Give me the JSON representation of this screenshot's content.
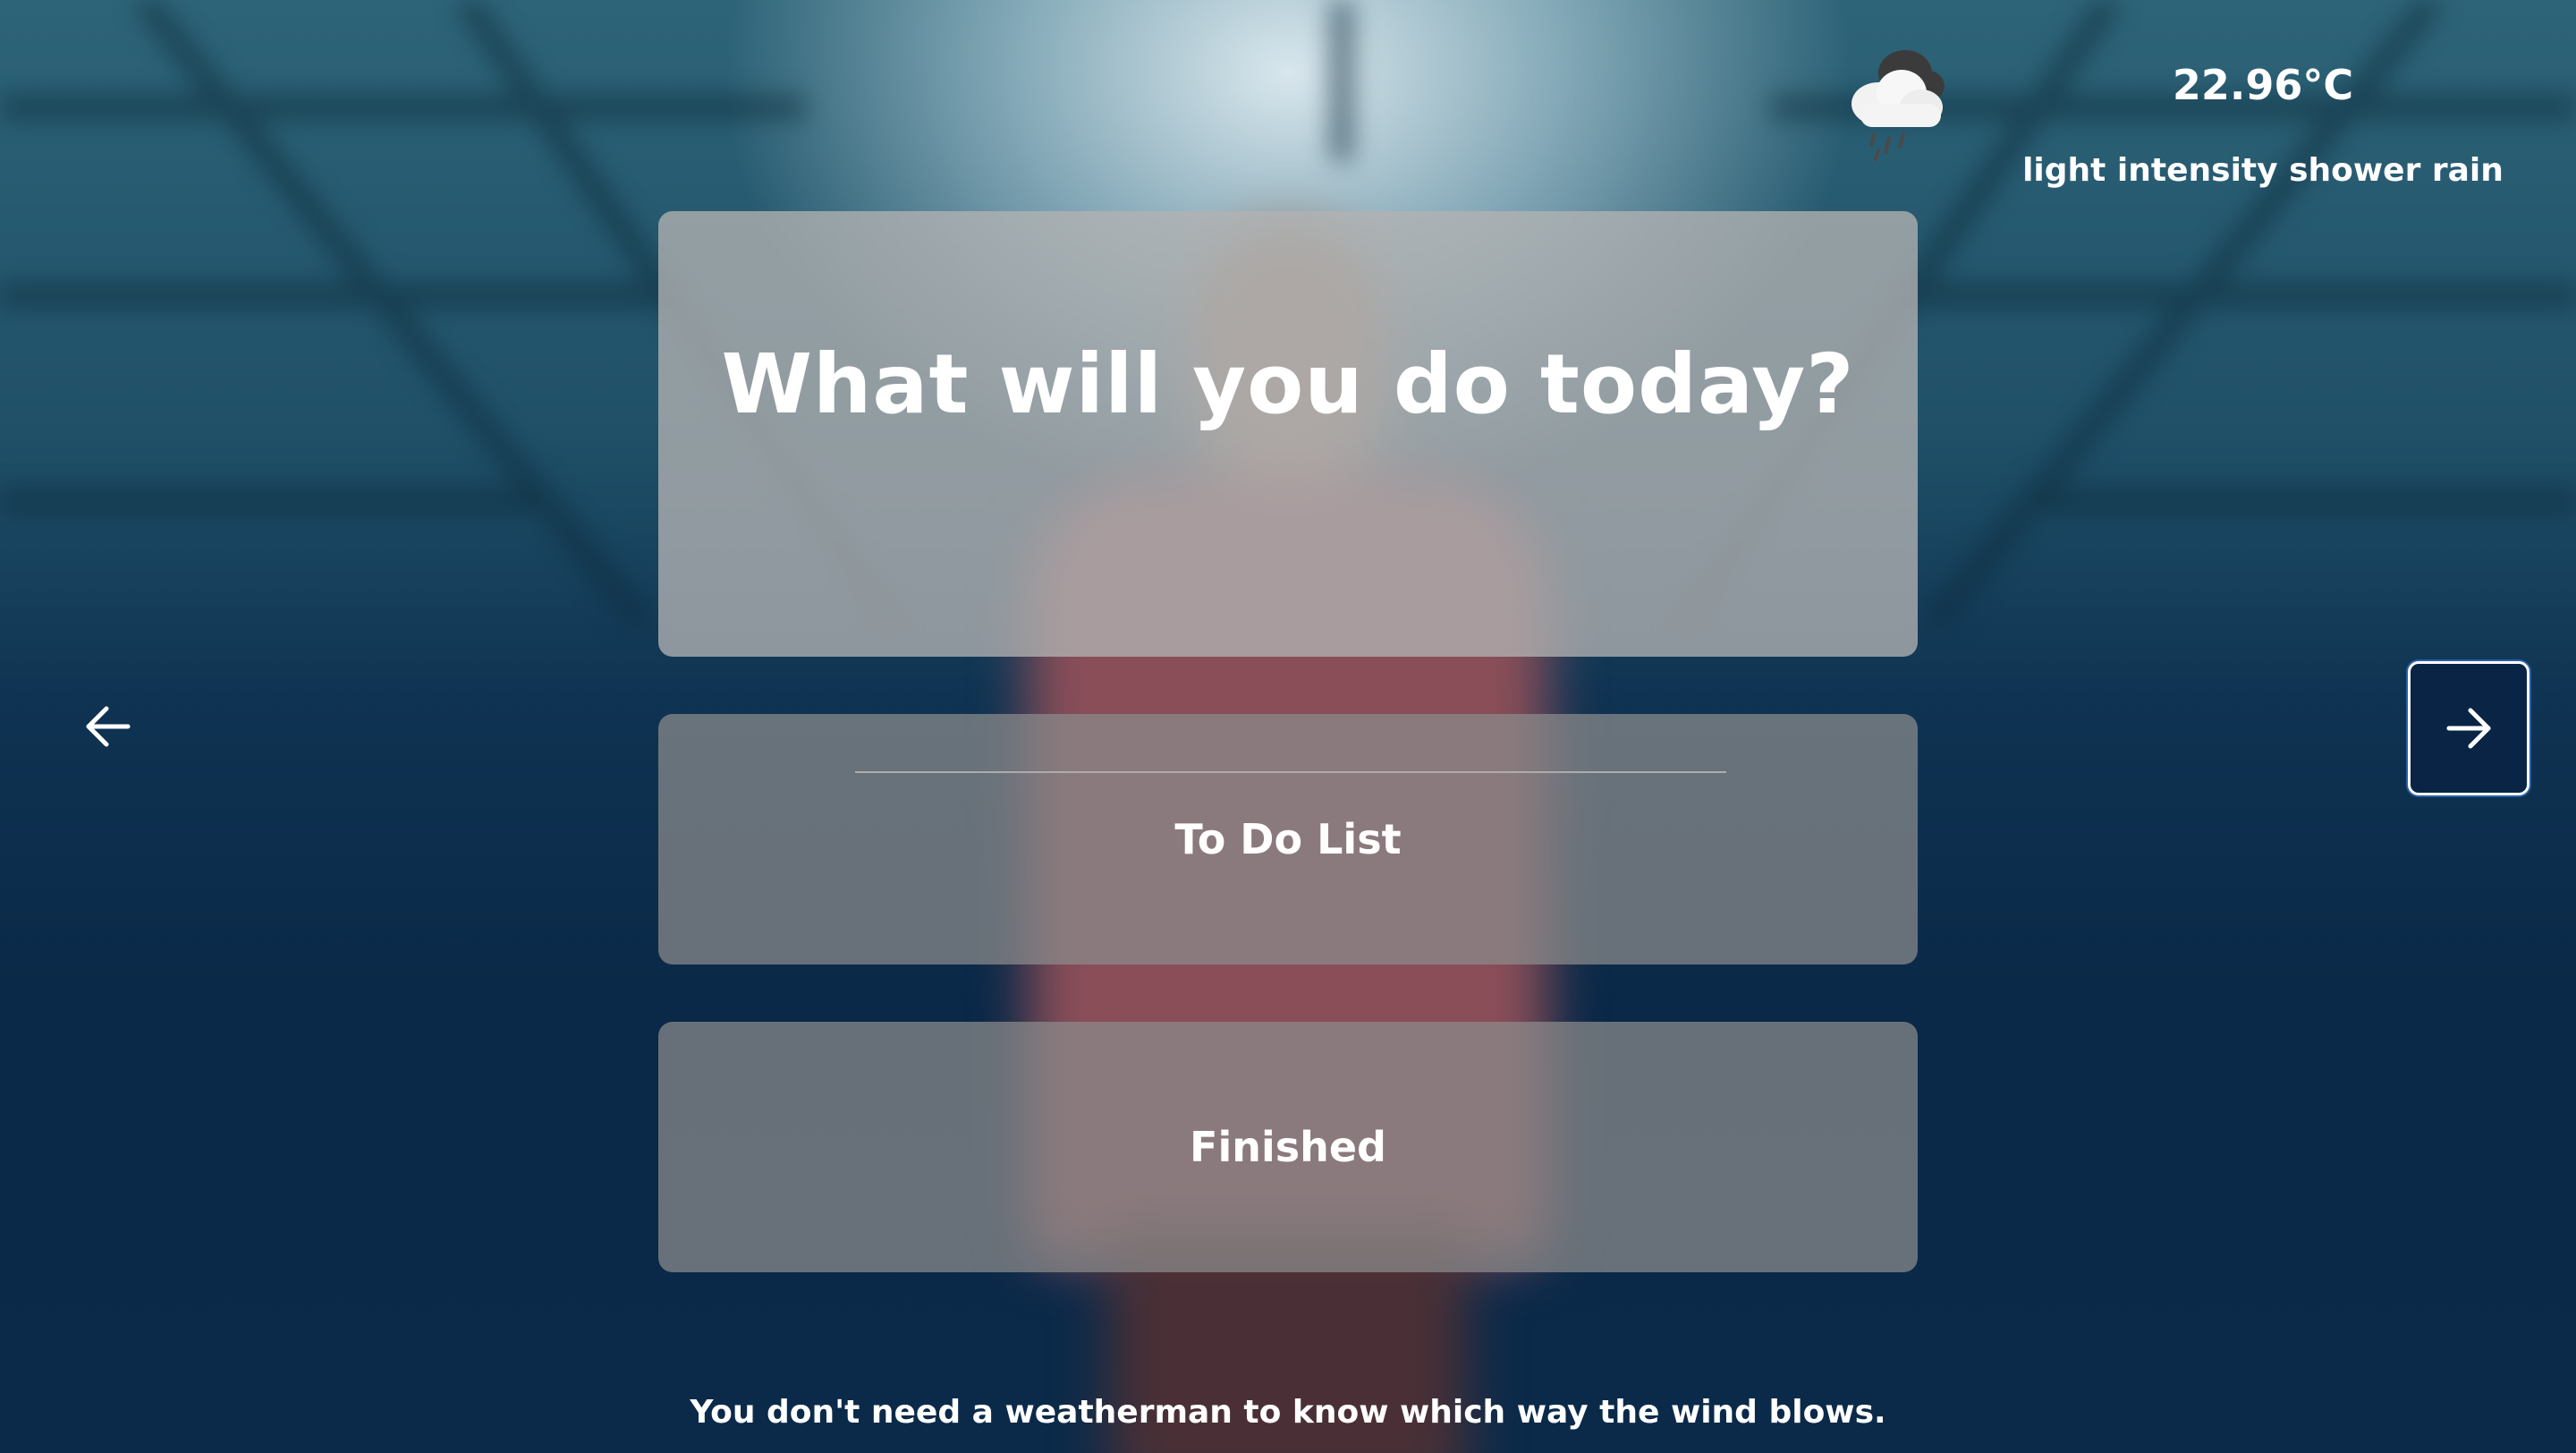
{
  "weather": {
    "icon": "rain-cloud-icon",
    "temperature": "22.96°C",
    "description": "light intensity shower rain"
  },
  "main": {
    "question": "What will you do today?",
    "task_input": {
      "value": "",
      "placeholder": ""
    },
    "options": [
      {
        "label": "To Do List"
      },
      {
        "label": "Finished"
      }
    ]
  },
  "navigation": {
    "prev_icon": "arrow-left-icon",
    "next_icon": "arrow-right-icon"
  },
  "footer": {
    "quote": "You don't need a weatherman to know which way the wind blows."
  },
  "colors": {
    "text": "#ffffff",
    "card_background": "#a0a0a0",
    "nav_active_background": "#0a2446",
    "nav_active_ring": "#2b5ea8"
  }
}
